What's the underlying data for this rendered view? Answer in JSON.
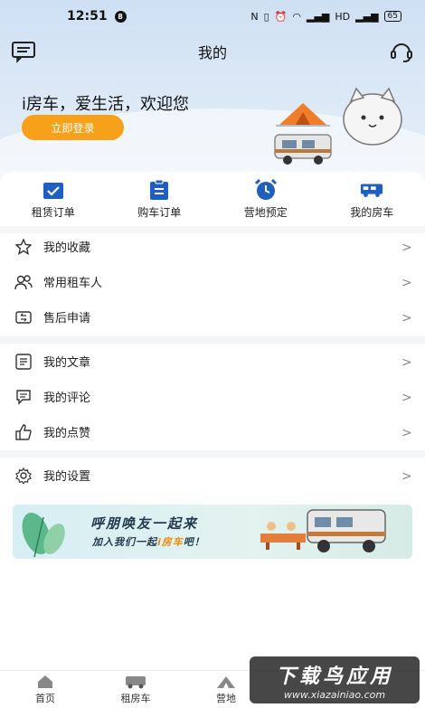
{
  "status_bar": {
    "time": "12:51",
    "notification_badge": "8",
    "battery": "65"
  },
  "header": {
    "title": "我的"
  },
  "hero": {
    "welcome_text": "i房车，爱生活，欢迎您",
    "login_label": "立即登录"
  },
  "quick_actions": [
    {
      "label": "租赁订单",
      "icon": "rental-order-icon"
    },
    {
      "label": "购车订单",
      "icon": "purchase-order-icon"
    },
    {
      "label": "营地预定",
      "icon": "alarm-clock-icon"
    },
    {
      "label": "我的房车",
      "icon": "rv-icon"
    }
  ],
  "menu_group_1": [
    {
      "label": "我的收藏",
      "icon": "star-icon"
    },
    {
      "label": "常用租车人",
      "icon": "users-icon"
    },
    {
      "label": "售后申请",
      "icon": "aftersale-icon"
    }
  ],
  "menu_group_2": [
    {
      "label": "我的文章",
      "icon": "article-icon"
    },
    {
      "label": "我的评论",
      "icon": "comment-icon"
    },
    {
      "label": "我的点赞",
      "icon": "thumbs-up-icon"
    }
  ],
  "menu_group_3": [
    {
      "label": "我的设置",
      "icon": "gear-icon"
    }
  ],
  "banner": {
    "line1": "呼朋唤友一起来",
    "line2_prefix": "加入我们一起",
    "line2_highlight": "i房车",
    "line2_suffix": "吧！"
  },
  "tabs": [
    {
      "label": "首页",
      "icon": "home-icon"
    },
    {
      "label": "租房车",
      "icon": "rv-icon"
    },
    {
      "label": "营地",
      "icon": "campsite-icon"
    }
  ],
  "watermark": {
    "title": "下载鸟应用",
    "url": "www.xiazainiao.com"
  },
  "colors": {
    "accent": "#f7a01a",
    "icon_blue": "#1f5fbf",
    "hero_bg": "#d6e5f5"
  }
}
